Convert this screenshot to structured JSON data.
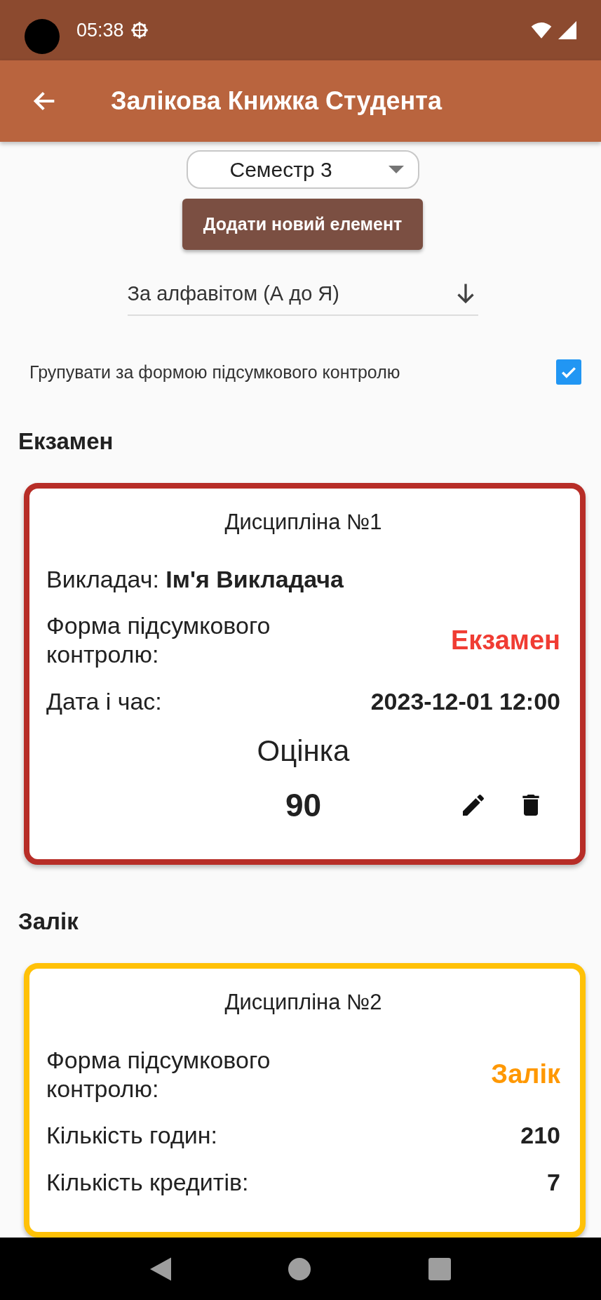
{
  "status_bar": {
    "time": "05:38"
  },
  "app_bar": {
    "title": "Залікова Книжка Студента"
  },
  "semester_dropdown": {
    "value": "Семестр 3"
  },
  "add_button": {
    "label": "Додати новий елемент"
  },
  "sort": {
    "value": "За алфавітом (А до Я)"
  },
  "group_option": {
    "label": "Групувати за формою підсумкового контролю",
    "checked": true
  },
  "groups": [
    {
      "title": "Екзамен",
      "cards": [
        {
          "title": "Дисципліна №1",
          "color": "#b72d27",
          "rows": [
            {
              "kind": "inline",
              "label": "Викладач:",
              "value": "Ім'я Викладача"
            },
            {
              "kind": "split",
              "label": "Форма підсумкового контролю:",
              "value": "Екзамен",
              "color": "#f03c33"
            },
            {
              "kind": "split",
              "label": "Дата і час:",
              "value": "2023-12-01 12:00"
            }
          ],
          "grade_label": "Оцінка",
          "grade": "90",
          "actions": true
        }
      ]
    },
    {
      "title": "Залік",
      "cards": [
        {
          "title": "Дисципліна №2",
          "color": "#ffc107",
          "rows": [
            {
              "kind": "split",
              "label": "Форма підсумкового контролю:",
              "value": "Залік",
              "color": "#ff9800"
            },
            {
              "kind": "split",
              "label": "Кількість годин:",
              "value": "210"
            },
            {
              "kind": "split",
              "label": "Кількість кредитів:",
              "value": "7"
            }
          ],
          "actions": false
        }
      ]
    }
  ]
}
